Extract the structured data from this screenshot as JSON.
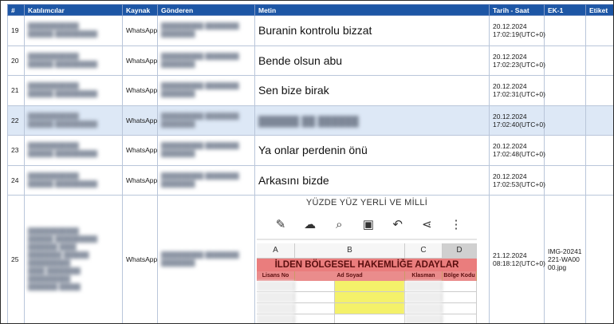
{
  "headers": [
    "#",
    "Katılımcılar",
    "Kaynak",
    "Gönderen",
    "Metin",
    "Tarih - Saat",
    "EK-1",
    "Etiket"
  ],
  "rows": [
    {
      "no": "19",
      "source": "WhatsApp",
      "message": "Buranin kontrolu bizzat",
      "date": "20.12.2024",
      "time": "17:02:19(UTC+0)",
      "attachment": ""
    },
    {
      "no": "20",
      "source": "WhatsApp",
      "message": "Bende olsun abu",
      "date": "20.12.2024",
      "time": "17:02:23(UTC+0)",
      "attachment": ""
    },
    {
      "no": "21",
      "source": "WhatsApp",
      "message": "Sen bize birak",
      "date": "20.12.2024",
      "time": "17:02:31(UTC+0)",
      "attachment": ""
    },
    {
      "no": "22",
      "source": "WhatsApp",
      "message": "",
      "date": "20.12.2024",
      "time": "17:02:40(UTC+0)",
      "attachment": ""
    },
    {
      "no": "23",
      "source": "WhatsApp",
      "message": "Ya onlar perdenin önü",
      "date": "20.12.2024",
      "time": "17:02:48(UTC+0)",
      "attachment": ""
    },
    {
      "no": "24",
      "source": "WhatsApp",
      "message": "Arkasını bizde",
      "date": "20.12.2024",
      "time": "17:02:53(UTC+0)",
      "attachment": ""
    },
    {
      "no": "25",
      "source": "WhatsApp",
      "message": "",
      "date": "21.12.2024",
      "time": "08:18:12(UTC+0)",
      "attachment": "IMG-20241221-WA0000.jpg"
    }
  ],
  "image": {
    "title": "YÜZDE YÜZ YERLİ VE MİLLİ",
    "columns": [
      "A",
      "B",
      "C",
      "D"
    ],
    "banner": "İLDEN BÖLGESEL HAKEMLİĞE ADAYLAR",
    "subheaders": [
      "Lisans No",
      "Ad Soyad",
      "Klasman",
      "Bölge Kodu"
    ]
  },
  "colors": {
    "header_bg": "#1d56a5",
    "selected_row": "#dde8f6",
    "banner": "#ea7d7d",
    "highlight": "#f4f16a"
  }
}
